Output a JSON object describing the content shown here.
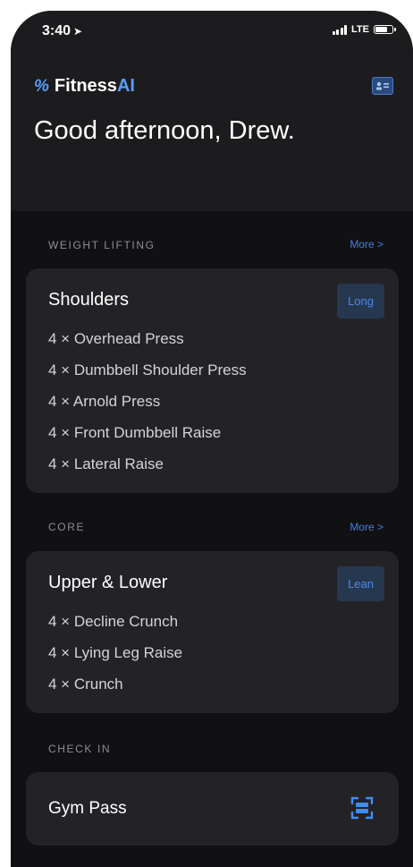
{
  "status_bar": {
    "time": "3:40",
    "location_arrow": "➤",
    "network": "LTE"
  },
  "header": {
    "brand_mark": "%",
    "brand_name": "Fitness",
    "brand_accent": "AI",
    "greeting": "Good afternoon, Drew."
  },
  "sections": {
    "weight_lifting": {
      "title": "WEIGHT LIFTING",
      "more": "More >",
      "card": {
        "title": "Shoulders",
        "badge": "Long",
        "exercises": [
          "4 × Overhead Press",
          "4 × Dumbbell Shoulder Press",
          "4 × Arnold Press",
          "4 × Front Dumbbell Raise",
          "4 × Lateral Raise"
        ]
      }
    },
    "core": {
      "title": "CORE",
      "more": "More >",
      "card": {
        "title": "Upper & Lower",
        "badge": "Lean",
        "exercises": [
          "4 × Decline Crunch",
          "4 × Lying Leg Raise",
          "4 × Crunch"
        ]
      }
    },
    "check_in": {
      "title": "CHECK IN",
      "card": {
        "title": "Gym Pass"
      }
    }
  },
  "colors": {
    "accent": "#3f7fe0",
    "background": "#111114",
    "card": "#232327",
    "header_bg": "#1c1c1f",
    "badge_bg": "#263850"
  },
  "icons": {
    "profile": "profile-card-icon",
    "scan": "scan-barcode-icon",
    "location": "location-arrow-icon",
    "signal": "signal-icon",
    "battery": "battery-icon"
  }
}
